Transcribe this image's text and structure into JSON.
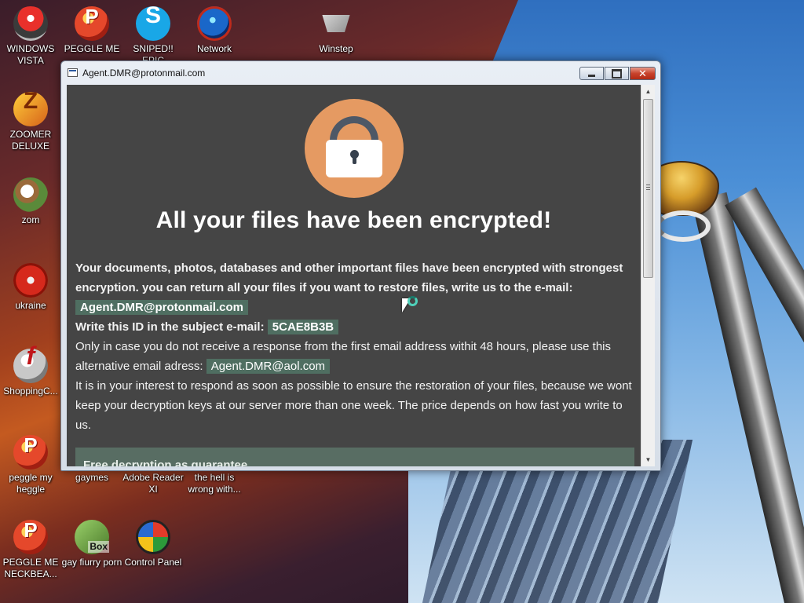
{
  "desktop": {
    "icons": [
      {
        "label": "WINDOWS VISTA",
        "icon": "vista-icon"
      },
      {
        "label": "PEGGLE ME",
        "icon": "peggle-icon"
      },
      {
        "label": "SNIPED!! EPIC",
        "icon": "skype-icon"
      },
      {
        "label": "Network",
        "icon": "network-icon"
      },
      {
        "label": "Winstep",
        "icon": "winstep-icon"
      },
      {
        "label": "ZOOMER DELUXE",
        "icon": "zoomer-icon"
      },
      {
        "label": "zom",
        "icon": "flower-icon"
      },
      {
        "label": "ukraine",
        "icon": "radiation-icon"
      },
      {
        "label": "ShoppingC...",
        "icon": "flash-icon"
      },
      {
        "label": "peggle my heggle",
        "icon": "peggle-icon"
      },
      {
        "label": "gaymes",
        "icon": "folder-icon"
      },
      {
        "label": "Adobe Reader XI",
        "icon": "adobe-reader-icon"
      },
      {
        "label": "the hell is wrong with...",
        "icon": "document-icon"
      },
      {
        "label": "PEGGLE ME NECKBEA...",
        "icon": "peggle-icon"
      },
      {
        "label": "gay fiurry porn",
        "icon": "box-icon"
      },
      {
        "label": "Control Panel",
        "icon": "control-panel-icon"
      }
    ]
  },
  "window": {
    "title": "Agent.DMR@protonmail.com",
    "buttons": {
      "minimize": "minimize",
      "maximize": "maximize",
      "close": "✕"
    },
    "headline": "All your files have been encrypted!",
    "para1_text": "Your documents, photos, databases and other important files have been encrypted with strongest encryption. you can return all your files if you want to restore files, write us to the e-mail:",
    "primary_email": "Agent.DMR@protonmail.com",
    "id_label": "Write this ID in the subject e-mail:",
    "id_value": "5CAE8B3B",
    "para2_text": "Only in case you do not receive a response from the first email address withit 48 hours, please use this alternative email adress:",
    "alt_email": "Agent.DMR@aol.com",
    "para3_text": "It is in your interest to respond as soon as possible to ensure the restoration of your files, because we wont keep your decryption keys at our server more than one week. The price depends on how fast you write to us.",
    "box_heading": "Free decryption as guarantee"
  },
  "colors": {
    "client_bg": "#454545",
    "lock_circle": "#e59a62",
    "highlight": "#4f6e61",
    "box": "#586d63"
  }
}
